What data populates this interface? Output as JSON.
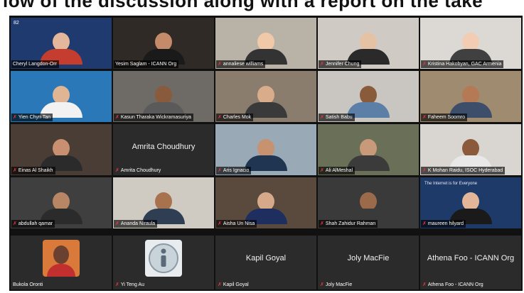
{
  "banner": {
    "text": "low of the discussion along with a report on the take"
  },
  "participants": [
    {
      "name": "Cheryl Langdon-Orr",
      "muted": false,
      "bg": "#1e3a6e",
      "skin": "#e3b79b",
      "shirt": "#c43d2f",
      "logo_text": "82"
    },
    {
      "name": "Yesim Saglam - ICANN Org",
      "muted": false,
      "bg": "#2f2a26",
      "skin": "#c48a6a",
      "shirt": "#1a1a1a",
      "active": true
    },
    {
      "name": "annaliese williams",
      "muted": true,
      "bg": "#b9b2a7",
      "skin": "#f0c9a8",
      "shirt": "#333333"
    },
    {
      "name": "Jennifer Chung",
      "muted": true,
      "bg": "#cfcac4",
      "skin": "#e6c2a4",
      "shirt": "#2a2a2a"
    },
    {
      "name": "Kristina Hakobyan, GAC Armenia",
      "muted": true,
      "bg": "#dcd8d3",
      "skin": "#f2cdb3",
      "shirt": "#404040"
    },
    {
      "name": "Yien Chyn Tan",
      "muted": true,
      "bg": "#2a78b8",
      "skin": "#e0b594",
      "shirt": "#f2f2f2"
    },
    {
      "name": "Kasun Tharaka Wickramasuriya",
      "muted": true,
      "bg": "#6e6b67",
      "skin": "#8a5a3c",
      "shirt": "#5a5a5a"
    },
    {
      "name": "Charles Mok",
      "muted": true,
      "bg": "#8a7d6e",
      "skin": "#d9ad8c",
      "shirt": "#3a3a3a"
    },
    {
      "name": "Satish Babu",
      "muted": true,
      "bg": "#c9c6c2",
      "skin": "#8a5b3b",
      "shirt": "#5b7fa6"
    },
    {
      "name": "Faheem Soomro",
      "muted": true,
      "bg": "#9f8b70",
      "skin": "#b57a55",
      "shirt": "#3d4e6a"
    },
    {
      "name": "Einas Al Shaikh",
      "muted": true,
      "bg": "#4a3d36",
      "skin": "#c89070",
      "shirt": "#2b2b2b"
    },
    {
      "name": "Amrita Choudhury",
      "muted": true,
      "bg": "#2b2b2b",
      "text_tile": "Amrita Choudhury"
    },
    {
      "name": "Aris Ignacio",
      "muted": true,
      "bg": "#9aa9b6",
      "skin": "#c79270",
      "shirt": "#1f3552"
    },
    {
      "name": "Ali AlMeshal",
      "muted": true,
      "bg": "#6a6f57",
      "skin": "#c89a7a",
      "shirt": "#3b3b3b"
    },
    {
      "name": "K Mohan Raidu, ISOC Hyderabad",
      "muted": true,
      "bg": "#d9d6d1",
      "skin": "#8a5a3a",
      "shirt": "#e8e8e8"
    },
    {
      "name": "abdullah qamar",
      "muted": true,
      "bg": "#3f3f3f",
      "skin": "#b88664",
      "shirt": "#2b2b2b"
    },
    {
      "name": "Ananda Niraula",
      "muted": true,
      "bg": "#cfcbc2",
      "skin": "#a8724f",
      "shirt": "#2f3e53"
    },
    {
      "name": "Aisha Un Nisa",
      "muted": true,
      "bg": "#5a4a3e",
      "skin": "#d6a98a",
      "shirt": "#1e2e5e"
    },
    {
      "name": "Shah Zahidur Rahman",
      "muted": true,
      "bg": "#3a3a3a",
      "skin": "#9a6a4a",
      "shirt": "#3a3a3a"
    },
    {
      "name": "maureen hilyard",
      "muted": true,
      "bg": "#1d3a68",
      "skin": "#e3b69a",
      "shirt": "#1a1a1a",
      "caption": "The Internet is for Everyone"
    },
    {
      "name": "Bukola Oronti",
      "muted": false,
      "bg": "#2b2b2b",
      "avatar": "photo"
    },
    {
      "name": "Yi Teng Au",
      "muted": true,
      "bg": "#2b2b2b",
      "avatar": "info"
    },
    {
      "name": "Kapil Goyal",
      "muted": true,
      "bg": "#2b2b2b",
      "text_tile": "Kapil Goyal"
    },
    {
      "name": "Joly MacFie",
      "muted": true,
      "bg": "#2b2b2b",
      "text_tile": "Joly MacFie"
    },
    {
      "name": "Athena Foo - ICANN Org",
      "muted": true,
      "bg": "#2b2b2b",
      "text_tile": "Athena Foo - ICANN Org"
    }
  ]
}
